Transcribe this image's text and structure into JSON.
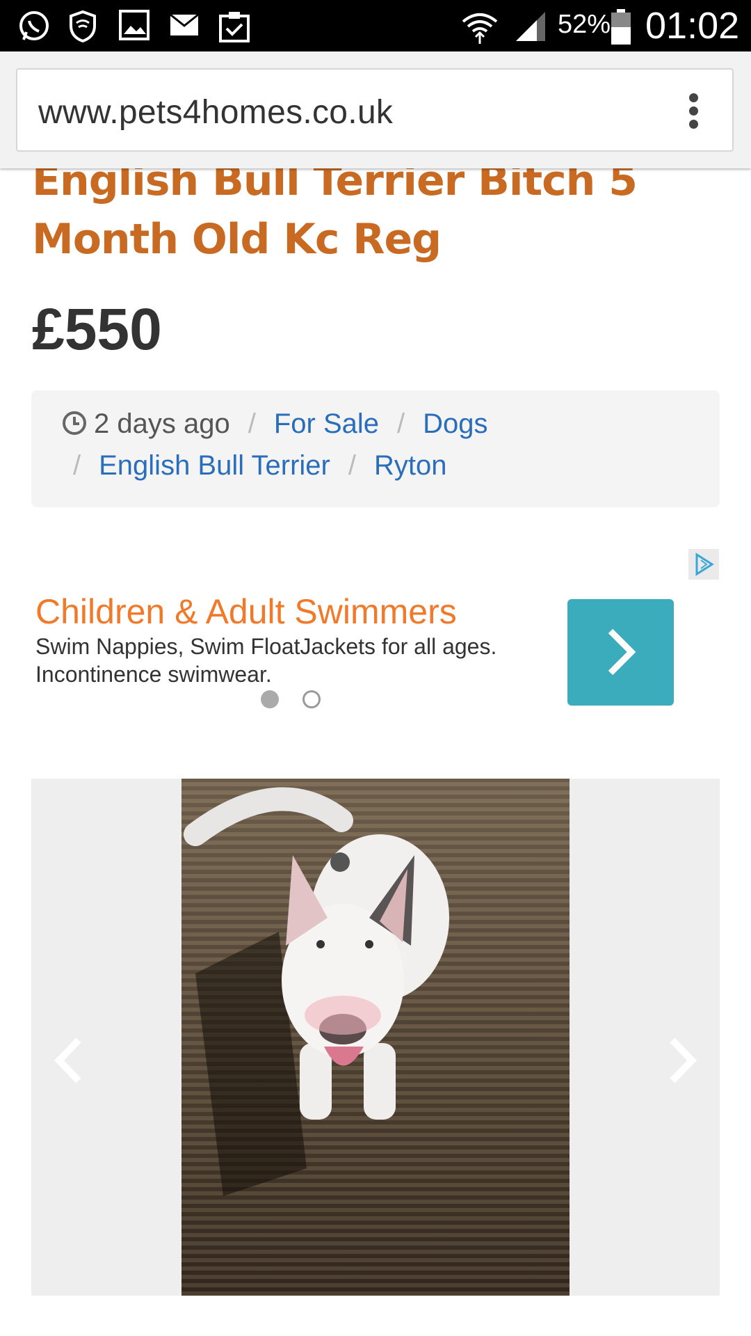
{
  "status_bar": {
    "battery_percent": "52%",
    "time": "01:02",
    "icons": [
      "whatsapp-icon",
      "shield-wifi-icon",
      "image-icon",
      "mail-icon",
      "clipboard-check-icon",
      "wifi-icon",
      "signal-icon",
      "battery-icon"
    ]
  },
  "browser": {
    "url": "www.pets4homes.co.uk",
    "menu_icon": "more-vert-icon"
  },
  "listing": {
    "title": "English Bull Terrier Bitch 5 Month Old Kc Reg",
    "price": "£550",
    "posted": "2 days ago",
    "breadcrumbs": [
      "For Sale",
      "Dogs",
      "English Bull Terrier",
      "Ryton"
    ]
  },
  "ad": {
    "title": "Children & Adult Swimmers",
    "description": "Swim Nappies, Swim FloatJackets for all ages. Incontinence swimwear.",
    "pagination": {
      "current": 1,
      "total": 2
    }
  },
  "gallery": {
    "prev_icon": "chevron-left-icon",
    "next_icon": "chevron-right-icon"
  },
  "colors": {
    "title": "#c86a22",
    "link": "#2a6ebb",
    "ad_title": "#f07a2a",
    "ad_button": "#3aacbc"
  }
}
